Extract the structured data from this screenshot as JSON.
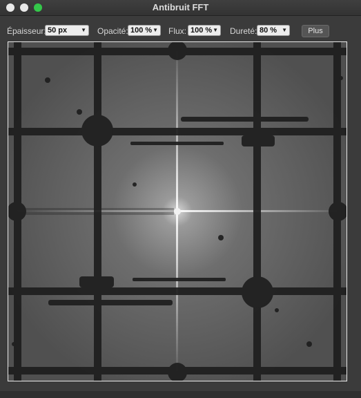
{
  "window": {
    "title": "Antibruit FFT"
  },
  "toolbar": {
    "thickness": {
      "label": "Épaisseur:",
      "value": "50 px"
    },
    "opacity": {
      "label": "Opacité:",
      "value": "100 %"
    },
    "flow": {
      "label": "Flux:",
      "value": "100 %"
    },
    "hardness": {
      "label": "Dureté:",
      "value": "80 %"
    },
    "more_label": "Plus"
  },
  "colors": {
    "spectrum_bg": "#6a6a6a",
    "mask": "#1f1f1f",
    "accent_green": "#34c84a"
  }
}
